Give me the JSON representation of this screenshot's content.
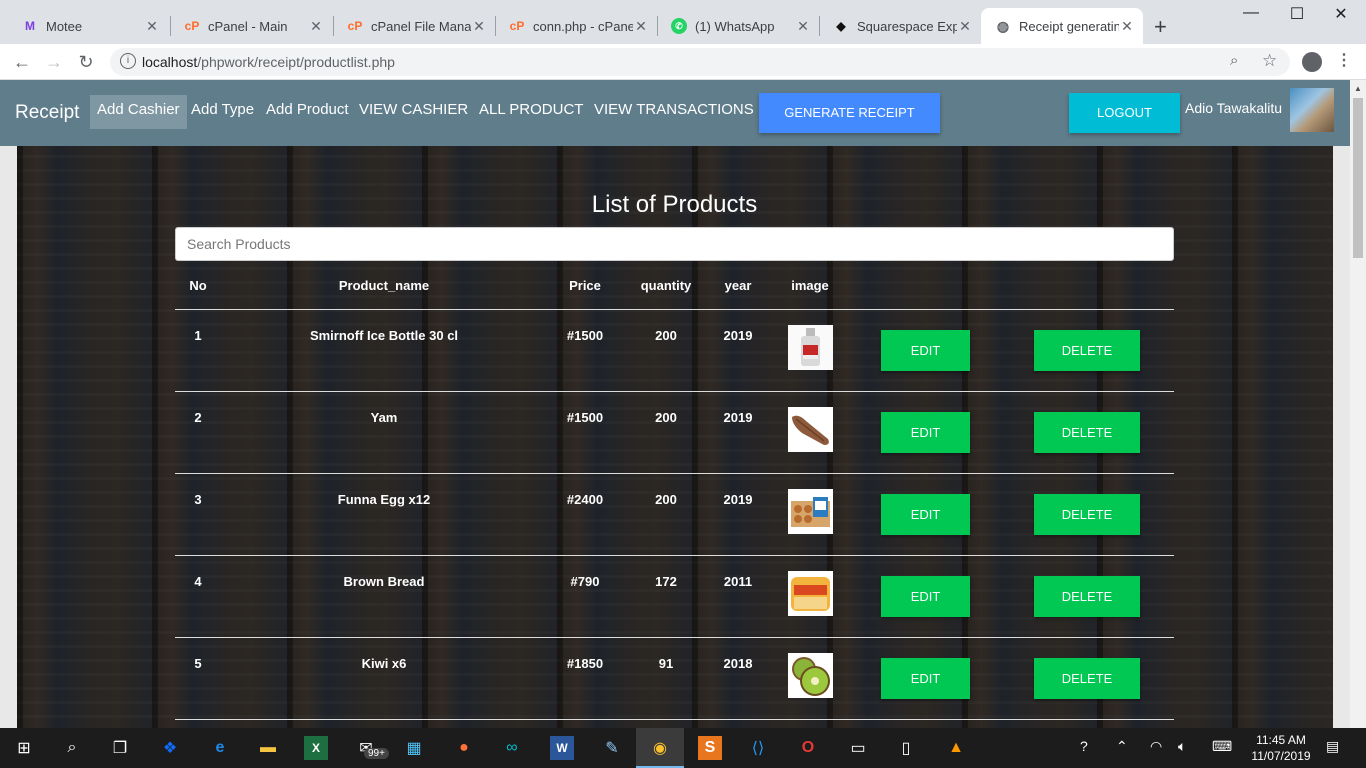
{
  "browser": {
    "tabs": [
      {
        "title": "Motee",
        "icon": "motee-icon"
      },
      {
        "title": "cPanel - Main",
        "icon": "cpanel-icon"
      },
      {
        "title": "cPanel File Manager",
        "icon": "cpanel-icon"
      },
      {
        "title": "conn.php - cPanel",
        "icon": "cpanel-icon"
      },
      {
        "title": "(1) WhatsApp",
        "icon": "whatsapp-icon"
      },
      {
        "title": "Squarespace Experience",
        "icon": "squarespace-icon"
      },
      {
        "title": "Receipt generating",
        "icon": "globe-icon"
      }
    ],
    "url_host": "localhost",
    "url_path": "/phpwork/receipt/productlist.php"
  },
  "nav": {
    "brand": "Receipt",
    "links": [
      "Add Cashier",
      "Add Type",
      "Add Product",
      "VIEW CASHIER",
      "ALL PRODUCT",
      "VIEW TRANSACTIONS"
    ],
    "generate_label": "GENERATE RECEIPT",
    "logout_label": "LOGOUT",
    "username": "Adio Tawakalitu"
  },
  "main": {
    "title": "List of Products",
    "search_placeholder": "Search Products",
    "columns": [
      "No",
      "Product_name",
      "Price",
      "quantity",
      "year",
      "image"
    ],
    "edit_label": "EDIT",
    "delete_label": "DELETE",
    "rows": [
      {
        "no": "1",
        "name": "Smirnoff Ice Bottle 30 cl",
        "price": "#1500",
        "quantity": "200",
        "year": "2019",
        "image": "bottle"
      },
      {
        "no": "2",
        "name": "Yam",
        "price": "#1500",
        "quantity": "200",
        "year": "2019",
        "image": "yam"
      },
      {
        "no": "3",
        "name": "Funna Egg x12",
        "price": "#2400",
        "quantity": "200",
        "year": "2019",
        "image": "eggs"
      },
      {
        "no": "4",
        "name": "Brown Bread",
        "price": "#790",
        "quantity": "172",
        "year": "2011",
        "image": "bread"
      },
      {
        "no": "5",
        "name": "Kiwi x6",
        "price": "#1850",
        "quantity": "91",
        "year": "2018",
        "image": "kiwi"
      }
    ]
  },
  "taskbar": {
    "time": "11:45 AM",
    "date": "11/07/2019",
    "store_badge": "99+"
  },
  "colors": {
    "navbar": "#607d8b",
    "generate": "#448aff",
    "logout": "#00bcd4",
    "action": "#00c853"
  }
}
